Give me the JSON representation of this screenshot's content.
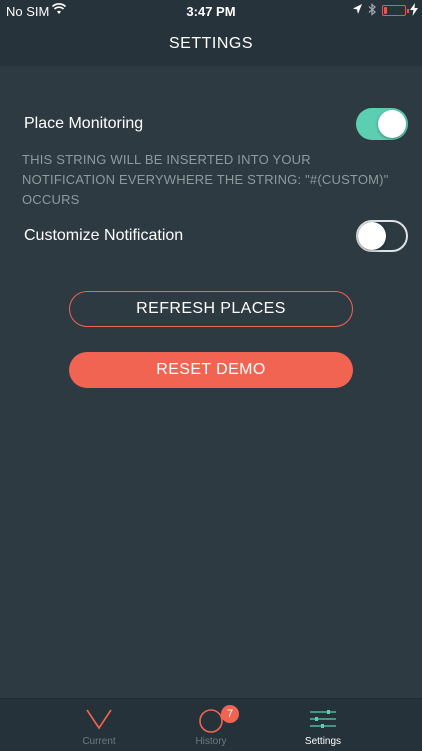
{
  "status_bar": {
    "carrier": "No SIM",
    "time": "3:47 PM",
    "battery_level": 0.15,
    "battery_color": "#ff4d4d"
  },
  "header": {
    "title": "SETTINGS"
  },
  "settings": {
    "place_monitoring": {
      "label": "Place Monitoring",
      "enabled": true
    },
    "description": "THIS STRING WILL BE INSERTED INTO YOUR NOTIFICATION EVERYWHERE THE STRING: \"#(CUSTOM)\" OCCURS",
    "customize_notification": {
      "label": "Customize Notification",
      "enabled": false
    }
  },
  "buttons": {
    "refresh_places": "REFRESH PLACES",
    "reset_demo": "RESET DEMO"
  },
  "tabbar": {
    "tabs": [
      {
        "label": "Current",
        "icon": "chevron-down-icon",
        "active": false
      },
      {
        "label": "History",
        "icon": "history-icon",
        "active": false,
        "badge": "7"
      },
      {
        "label": "Settings",
        "icon": "sliders-icon",
        "active": true
      }
    ]
  },
  "colors": {
    "accent": "#f26452",
    "toggle_on": "#5ccfb2",
    "background": "#2d3a42",
    "header_bg": "#27333a"
  }
}
